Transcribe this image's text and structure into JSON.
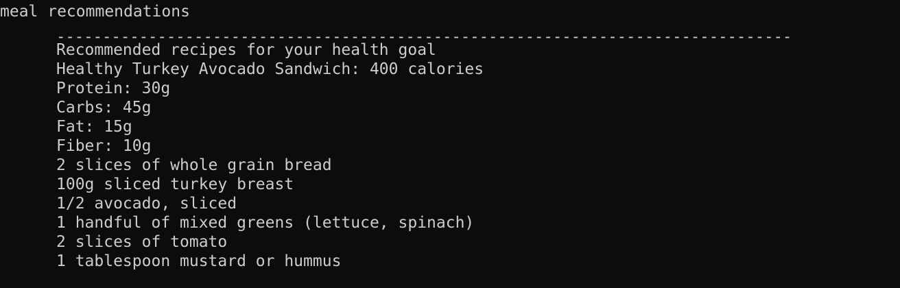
{
  "terminal": {
    "prompt_line": "meal recommendations",
    "separator": "--------------------------------------------------------------------------------",
    "lines": [
      "Recommended recipes for your health goal",
      "Healthy Turkey Avocado Sandwich: 400 calories",
      "Protein: 30g",
      "Carbs: 45g",
      "Fat: 15g",
      "Fiber: 10g",
      "2 slices of whole grain bread",
      "100g sliced turkey breast",
      "1/2 avocado, sliced",
      "1 handful of mixed greens (lettuce, spinach)",
      "2 slices of tomato",
      "1 tablespoon mustard or hummus"
    ],
    "colors": {
      "background": "#0c0c0c",
      "text": "#cccccc"
    }
  }
}
